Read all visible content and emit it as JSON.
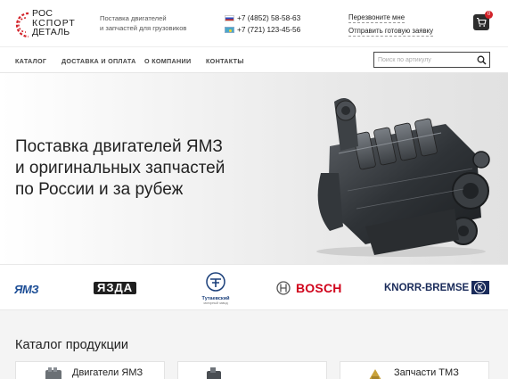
{
  "logo": {
    "line1": "РОС",
    "line2": "КСПОРТ",
    "line3": "ДЕТАЛЬ"
  },
  "tagline": {
    "line1": "Поставка двигателей",
    "line2": "и запчастей для грузовиков"
  },
  "phones": [
    {
      "flag": "ru",
      "number": "+7 (4852) 58-58-63"
    },
    {
      "flag": "kz",
      "number": "+7 (721) 123-45-56"
    }
  ],
  "header_links": {
    "callback": "Перезвоните мне",
    "send_request": "Отправить готовую заявку"
  },
  "cart": {
    "count": "0",
    "icon": "cart-icon"
  },
  "nav": {
    "items": [
      {
        "label": "КАТАЛОГ"
      },
      {
        "label": "ДОСТАВКА И ОПЛАТА"
      },
      {
        "label": "О КОМПАНИИ"
      },
      {
        "label": "КОНТАКТЫ"
      }
    ]
  },
  "search": {
    "placeholder": "Поиск по артикулу",
    "icon": "search-icon"
  },
  "hero": {
    "line1": "Поставка двигателей ЯМЗ",
    "line2": "и оригинальных запчастей",
    "line3": "по России и за рубеж"
  },
  "brands": {
    "yamz": "ЯМЗ",
    "yazda": "ЯЗДА",
    "tutaev_name": "Тутаевский",
    "tutaev_sub": "моторный завод",
    "bosch": "BOSCH",
    "knorr": "KNORR-BREMSE"
  },
  "catalog": {
    "title": "Каталог продукции",
    "cards": [
      {
        "label": "Двигатели ЯМЗ"
      },
      {
        "label": ""
      },
      {
        "label": "Запчасти ТМЗ"
      }
    ]
  },
  "colors": {
    "brand_red": "#d2232a",
    "dark": "#2d2d2d",
    "bosch_red": "#d0021b",
    "knorr_blue": "#1a2b5a",
    "yamz_blue": "#1d4e96"
  }
}
